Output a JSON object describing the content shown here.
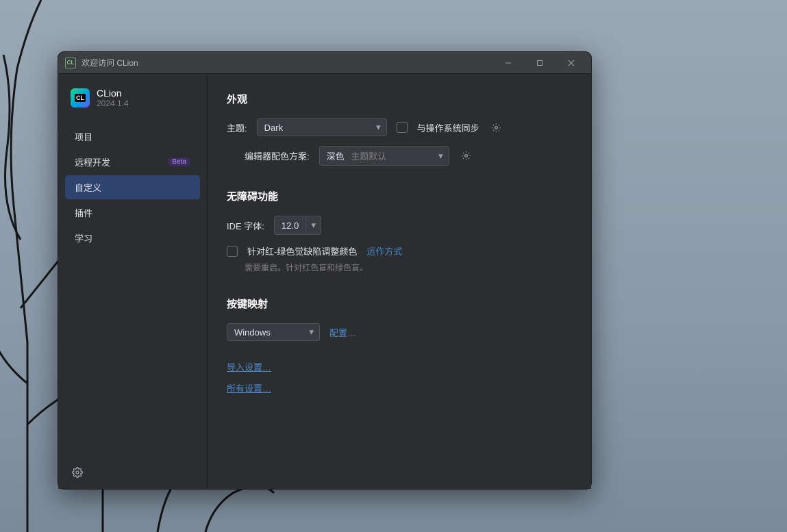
{
  "titlebar": {
    "title": "欢迎访问 CLion",
    "app_icon_label": "CL"
  },
  "product": {
    "name": "CLion",
    "version": "2024.1.4",
    "logo_text": "CL"
  },
  "sidebar": {
    "items": [
      {
        "label": "项目",
        "badge": null,
        "active": false
      },
      {
        "label": "远程开发",
        "badge": "Beta",
        "active": false
      },
      {
        "label": "自定义",
        "badge": null,
        "active": true
      },
      {
        "label": "插件",
        "badge": null,
        "active": false
      },
      {
        "label": "学习",
        "badge": null,
        "active": false
      }
    ]
  },
  "sections": {
    "appearance": {
      "title": "外观",
      "theme_label": "主题:",
      "theme_value": "Dark",
      "sync_checkbox_label": "与操作系统同步",
      "color_scheme_label": "编辑器配色方案:",
      "color_scheme_value": "深色",
      "color_scheme_placeholder": "主题默认"
    },
    "accessibility": {
      "title": "无障碍功能",
      "font_label": "IDE 字体:",
      "font_value": "12.0",
      "cb_label": "针对红-绿色觉缺陷调整颜色",
      "cb_link": "运作方式",
      "cb_hint": "需要重启。针对红色盲和绿色盲。"
    },
    "keymap": {
      "title": "按键映射",
      "value": "Windows",
      "configure": "配置…"
    },
    "links": {
      "import": "导入设置…",
      "all": "所有设置…"
    }
  }
}
